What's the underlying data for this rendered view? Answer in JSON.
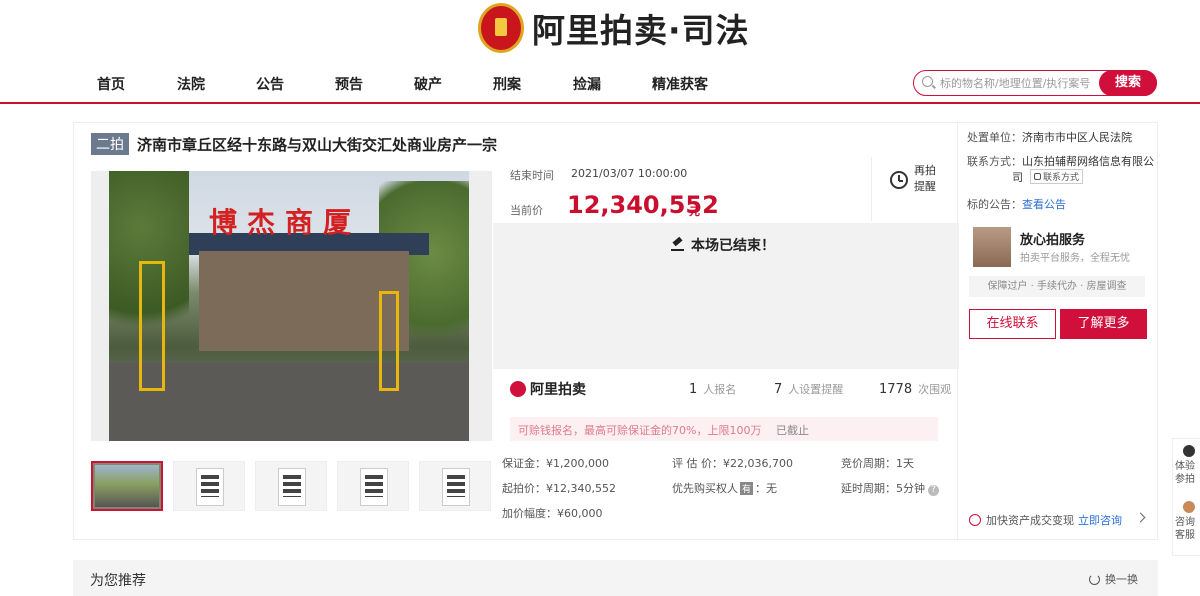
{
  "header": {
    "logo_text": "阿里拍卖·司法",
    "nav": [
      "首页",
      "法院",
      "公告",
      "预告",
      "破产",
      "刑案",
      "捡漏",
      "精准获客"
    ],
    "search": {
      "placeholder": "标的物名称/地理位置/执行案号",
      "button": "搜索"
    }
  },
  "lot": {
    "round_tag": "二拍",
    "title": "济南市章丘区经十东路与双山大街交汇处商业房产一宗"
  },
  "auction": {
    "end_label": "结束时间",
    "end_time": "2021/03/07 10:00:00",
    "price_label": "当前价",
    "price": "12,340,552",
    "price_unit": "元",
    "remind_label": "再拍提醒",
    "ended_text": "本场已结束！",
    "brand": "阿里拍卖",
    "stats": [
      {
        "value": "1",
        "label": "人报名"
      },
      {
        "value": "7",
        "label": "人设置提醒"
      },
      {
        "value": "1778",
        "label": "次围观"
      }
    ],
    "notice_text": "可赊钱报名，最高可赊保证金的70%，上限100万",
    "notice_status": "已截止",
    "info": {
      "deposit": "保证金：¥1,200,000",
      "appraisal": "评 估 价：¥22,036,700",
      "bid_cycle": "竞价周期：1天",
      "start_price": "起拍价：¥12,340,552",
      "priority_label": "优先购买权人",
      "priority_badge": "有",
      "priority_value": "：无",
      "delay_cycle": "延时周期：5分钟",
      "increment": "加价幅度：¥60,000"
    }
  },
  "side": {
    "court_label": "处置单位：",
    "court": "济南市市中区人民法院",
    "contact_label": "联系方式：",
    "contact_line1": "山东拍辅帮网络信息有限公",
    "contact_line2": "司",
    "contact_tag": "联系方式",
    "notice_label": "标的公告：",
    "notice_link": "查看公告",
    "service_title": "放心拍服务",
    "service_sub": "拍卖平台服务，全程无忧",
    "service_tags": "保障过户 · 手续代办 · 房屋调查",
    "btn_online": "在线联系",
    "btn_more": "了解更多",
    "consult_text": "加快资产成交变现",
    "consult_link": "立即咨询"
  },
  "recommend": {
    "title": "为您推荐",
    "refresh": "换一换"
  },
  "float_side": {
    "item1": "体验参拍",
    "item2": "咨询客服"
  },
  "photo_sign": "博杰商厦",
  "colors": {
    "accent": "#d0103a",
    "price": "#c8102e",
    "link": "#2a6fd6"
  }
}
